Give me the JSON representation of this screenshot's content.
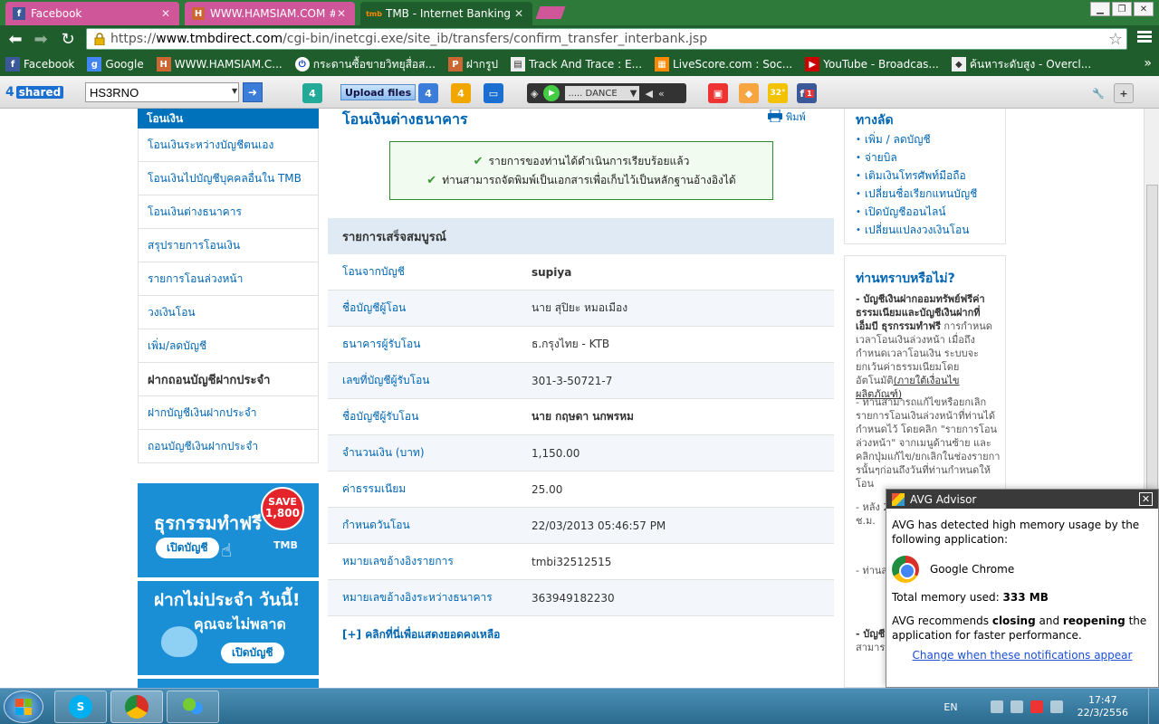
{
  "tabs": [
    {
      "label": "Facebook",
      "icon": "facebook-icon"
    },
    {
      "label": "WWW.HAMSIAM.COM #",
      "icon": "hamsiam-icon"
    },
    {
      "label": "TMB - Internet Banking",
      "icon": "tmb-icon"
    }
  ],
  "address_bar": {
    "scheme": "https://",
    "host": "www.tmbdirect.com",
    "path": "/cgi-bin/inetcgi.exe/site_ib/transfers/confirm_transfer_interbank.jsp"
  },
  "bookmarks": [
    {
      "label": "Facebook",
      "icon": "facebook-icon",
      "color": "#3b5998"
    },
    {
      "label": "Google",
      "icon": "google-icon",
      "color": "#4285f4"
    },
    {
      "label": "WWW.HAMSIAM.C...",
      "icon": "hamsiam-icon",
      "color": "#c63"
    },
    {
      "label": "กระดานซื้อขายวิทยุสื่อส...",
      "icon": "power-icon",
      "color": "#03c"
    },
    {
      "label": "ฝากรูป",
      "icon": "photo-icon",
      "color": "#c63"
    },
    {
      "label": "Track And Trace : E...",
      "icon": "document-icon",
      "color": "#eee"
    },
    {
      "label": "LiveScore.com : Soc...",
      "icon": "livescore-icon",
      "color": "#f80"
    },
    {
      "label": "YouTube - Broadcas...",
      "icon": "youtube-icon",
      "color": "#c00"
    },
    {
      "label": "ค้นหาระดับสูง - Overcl...",
      "icon": "diamond-icon",
      "color": "#eee"
    }
  ],
  "ext_toolbar": {
    "logo_text": "4",
    "logo_sub": "shared",
    "search_value": "HS3RNO",
    "upload_label": "Upload files",
    "radio_station": "..... DANCE",
    "weather_temp": "32°",
    "fb_count": "1"
  },
  "left_nav": {
    "header": "โอนเงิน",
    "items": [
      {
        "label": "โอนเงินระหว่างบัญชีตนเอง",
        "section": false
      },
      {
        "label": "โอนเงินไปบัญชีบุคคลอื่นใน TMB",
        "section": false
      },
      {
        "label": "โอนเงินต่างธนาคาร",
        "section": false
      },
      {
        "label": "สรุปรายการโอนเงิน",
        "section": false
      },
      {
        "label": "รายการโอนล่วงหน้า",
        "section": false
      },
      {
        "label": "วงเงินโอน",
        "section": false
      },
      {
        "label": "เพิ่ม/ลดบัญชี",
        "section": false
      },
      {
        "label": "ฝากถอนบัญชีฝากประจำ",
        "section": true
      },
      {
        "label": "ฝากบัญชีเงินฝากประจำ",
        "section": false
      },
      {
        "label": "ถอนบัญชีเงินฝากประจำ",
        "section": false
      }
    ],
    "banner1": {
      "title": "ธุรกรรมทำฟรี",
      "button": "เปิดบัญชี",
      "save_line1": "SAVE",
      "save_line2": "1,800",
      "brand": "TMB"
    },
    "banner2": {
      "line1": "ฝากไม่ประจำ วันนี้!",
      "line2": "คุณจะไม่พลาด",
      "button": "เปิดบัญชี"
    }
  },
  "main": {
    "title": "โอนเงินต่างธนาคาร",
    "print_label": "พิมพ์",
    "success_lines": [
      "รายการของท่านได้ดำเนินการเรียบร้อยแล้ว",
      "ท่านสามารถจัดพิมพ์เป็นเอกสารเพื่อเก็บไว้เป็นหลักฐานอ้างอิงได้"
    ],
    "summary_header": "รายการเสร็จสมบูรณ์",
    "rows": [
      {
        "label": "โอนจากบัญชี",
        "value": "supiya",
        "bold": true
      },
      {
        "label": "ชื่อบัญชีผู้โอน",
        "value": "นาย สุปิยะ หมอเมือง",
        "bold": false
      },
      {
        "label": "ธนาคารผู้รับโอน",
        "value": "ธ.กรุงไทย - KTB",
        "bold": false
      },
      {
        "label": "เลขที่บัญชีผู้รับโอน",
        "value": "301-3-50721-7",
        "bold": false
      },
      {
        "label": "ชื่อบัญชีผู้รับโอน",
        "value": "นาย กฤษดา นกพรหม",
        "bold": true
      },
      {
        "label": "จำนวนเงิน (บาท)",
        "value": "1,150.00",
        "bold": false
      },
      {
        "label": "ค่าธรรมเนียม",
        "value": "25.00",
        "bold": false
      },
      {
        "label": "กำหนดวันโอน",
        "value": "22/03/2013 05:46:57 PM",
        "bold": false
      },
      {
        "label": "หมายเลขอ้างอิงรายการ",
        "value": "tmbi32512515",
        "bold": false
      },
      {
        "label": "หมายเลขอ้างอิงระหว่างธนาคาร",
        "value": "363949182230",
        "bold": false
      }
    ],
    "balance_link": "[+] คลิกที่นี่เพื่อแสดงยอดคงเหลือ"
  },
  "right": {
    "shortcuts_title": "ทางลัด",
    "shortcuts": [
      "เพิ่ม / ลดบัญชี",
      "จ่ายบิล",
      "เติมเงินโทรศัพท์มือถือ",
      "เปลี่ยนชื่อเรียกแทนบัญชี",
      "เปิดบัญชีออนไลน์",
      "เปลี่ยนแปลงวงเงินโอน"
    ],
    "didyouknow_title": "ท่านทราบหรือไม่?",
    "tip1_bold": "- บัญชีเงินฝากออมทรัพย์ฟรีค่าธรรมเนียมและบัญชีเงินฝากที่เอ็มบี ธุรกรรมทำฟรี",
    "tip1_text": " การกำหนดเวลาโอนเงินล่วงหน้า เมื่อถึงกำหนดเวลาโอนเงิน ระบบจะยกเว้นค่าธรรมเนียมโดยอัตโนมัติ",
    "tip1_link": "(ภายใต้เงื่อนไขผลิตภัณฑ์)",
    "tip2": "- ท่านสามารถแก้ไขหรือยกเลิกรายการโอนเงินล่วงหน้าที่ท่านได้กำหนดไว้ โดยคลิก \"รายการโอนล่วงหน้า\" จากเมนูด้านซ้าย และคลิกปุ่มแก้ไข/ยกเลิกในช่องรายการนั้นๆก่อนถึงวันที่ท่านกำหนดให้โอน",
    "tip3": "- หลัง 2 วันนี้ท่า ธนาคาร 24 ช.ม.",
    "tip4": "- ท่านส โอนได้ ฝาก/จัด \"เปลี่ยน",
    "tip5_bold": "- บัญชี ค่าธรร ฝากที่เ",
    "tip5_text": "สามาร โดยไม่"
  },
  "avg": {
    "title": "AVG Advisor",
    "message": "AVG has detected high memory usage by the following application:",
    "app_name": "Google Chrome",
    "memory_label": "Total memory used:",
    "memory_value": "333 MB",
    "rec_prefix": "AVG recommends",
    "rec_closing": "closing",
    "rec_and": "and",
    "rec_reopening": "reopening",
    "rec_suffix": "the application for faster performance.",
    "link": "Change when these notifications appear"
  },
  "taskbar": {
    "lang": "EN",
    "time": "17:47",
    "date": "22/3/2556"
  }
}
